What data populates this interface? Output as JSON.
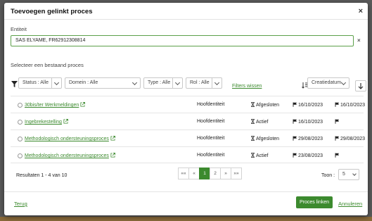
{
  "modal": {
    "title": "Toevoegen gelinkt proces"
  },
  "entity": {
    "label": "Entiteit",
    "value": "SAS ELYAME, FR62912308814"
  },
  "section": {
    "label": "Selecteer een bestaand proces"
  },
  "filters": {
    "status": "Status : Alle",
    "domain": "Domein : Alle",
    "type": "Type : Alle",
    "role": "Rol : Alle",
    "clear": "Filters wissen"
  },
  "sort": {
    "field": "Creatiedatum"
  },
  "rows": [
    {
      "name": "30bis/ter Werkmeldingen",
      "role": "Hoofdentiteit",
      "status": "Afgesloten",
      "date1": "16/10/2023",
      "date2": "16/10/2023"
    },
    {
      "name": "Ingebrekestelling",
      "role": "Hoofdentiteit",
      "status": "Actief",
      "date1": "16/10/2023",
      "date2": ""
    },
    {
      "name": "Methodologisch ondersteuningsproces",
      "role": "Hoofdentiteit",
      "status": "Afgesloten",
      "date1": "29/08/2023",
      "date2": "29/08/2023"
    },
    {
      "name": "Methodologisch ondersteuningsproces",
      "role": "Hoofdentiteit",
      "status": "Actief",
      "date1": "23/08/2023",
      "date2": ""
    }
  ],
  "results": "Resultaten 1 - 4 van 10",
  "pagination": {
    "first": "«« ",
    "prev": "«",
    "pages": [
      "1",
      "2"
    ],
    "next": "»",
    "last": "»»"
  },
  "show": {
    "label": "Toon :",
    "value": "5"
  },
  "footer": {
    "back": "Terug",
    "link_button": "Proces linken",
    "cancel": "Annuleren"
  },
  "colors": {
    "accent": "#3c8a2e"
  }
}
